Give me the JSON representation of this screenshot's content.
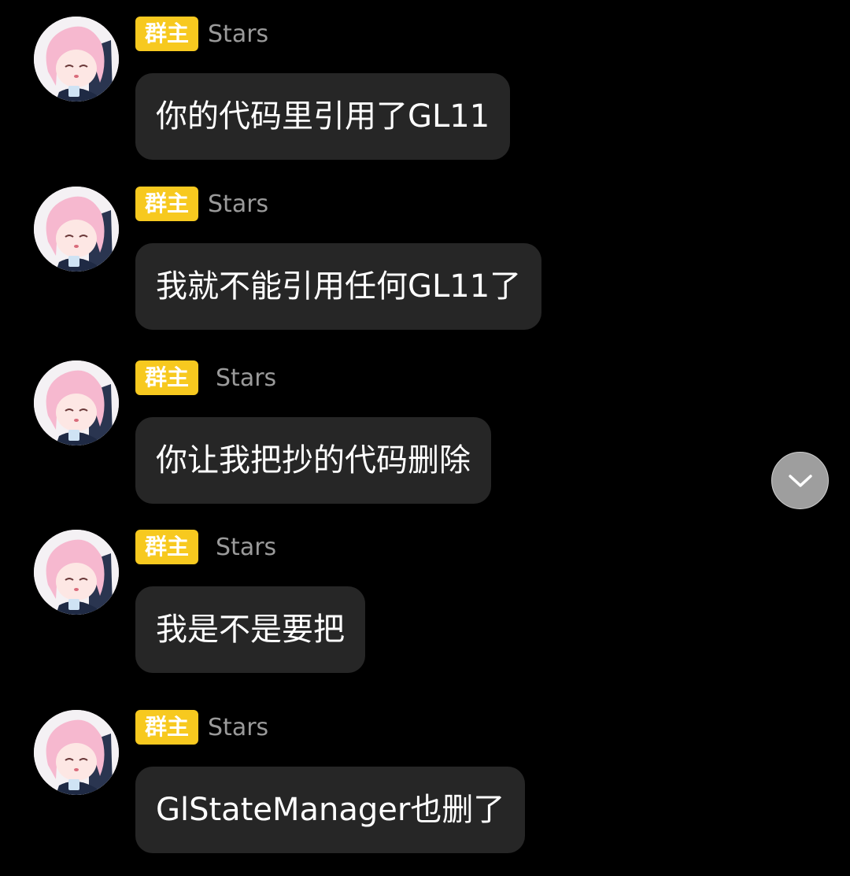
{
  "messages": [
    {
      "role_badge": "群主",
      "sender": "Stars",
      "text": "你的代码里引用了GL11"
    },
    {
      "role_badge": "群主",
      "sender": "Stars",
      "text": "我就不能引用任何GL11了"
    },
    {
      "role_badge": "群主",
      "sender": "Stars",
      "text": "你让我把抄的代码删除"
    },
    {
      "role_badge": "群主",
      "sender": "Stars",
      "text": "我是不是要把"
    },
    {
      "role_badge": "群主",
      "sender": "Stars",
      "text": "GlStateManager也删了"
    }
  ],
  "colors": {
    "background": "#000000",
    "bubble": "#262626",
    "badge": "#f7c91f",
    "sender_name": "#9a9a9a",
    "scroll_button": "#9e9e9e"
  },
  "icons": {
    "scroll_button": "chevron-down-icon",
    "avatar": "anime-avatar-icon"
  }
}
